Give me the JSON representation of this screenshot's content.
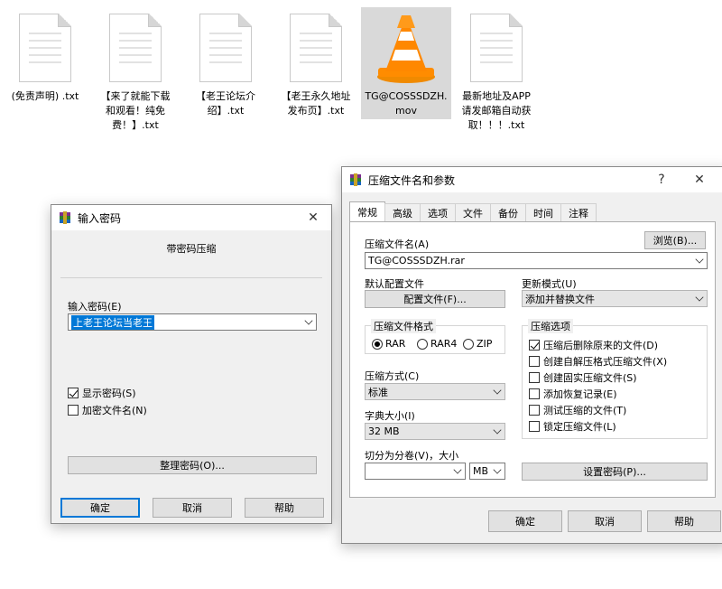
{
  "files": [
    {
      "name": "(免责声明) .txt",
      "type": "txt"
    },
    {
      "name": "【来了就能下载\n和观看！纯免\n费！】.txt",
      "type": "txt"
    },
    {
      "name": "【老王论坛介\n绍】.txt",
      "type": "txt"
    },
    {
      "name": "【老王永久地址\n发布页】.txt",
      "type": "txt"
    },
    {
      "name": "TG@COSSSDZH.\nmov",
      "type": "video"
    },
    {
      "name": "最新地址及APP\n请发邮箱自动获\n取！！！.txt",
      "type": "txt"
    }
  ],
  "password_dialog": {
    "title": "输入密码",
    "close": "✕",
    "subtitle": "带密码压缩",
    "password_label": "输入密码(E)",
    "password_value": "上老王论坛当老王",
    "show_password": "显示密码(S)",
    "encrypt_names": "加密文件名(N)",
    "organize_button": "整理密码(O)...",
    "ok": "确定",
    "cancel": "取消",
    "help": "帮助"
  },
  "archive_dialog": {
    "title": "压缩文件名和参数",
    "help_icon": "?",
    "close": "✕",
    "tabs": [
      "常规",
      "高级",
      "选项",
      "文件",
      "备份",
      "时间",
      "注释"
    ],
    "archive_name_label": "压缩文件名(A)",
    "browse": "浏览(B)...",
    "archive_name_value": "TG@COSSSDZH.rar",
    "default_profile_label": "默认配置文件",
    "profiles_button": "配置文件(F)...",
    "update_mode_label": "更新模式(U)",
    "update_mode_value": "添加并替换文件",
    "format_group": "压缩文件格式",
    "formats": [
      "RAR",
      "RAR4",
      "ZIP"
    ],
    "method_label": "压缩方式(C)",
    "method_value": "标准",
    "dict_label": "字典大小(I)",
    "dict_value": "32 MB",
    "split_label": "切分为分卷(V)，大小",
    "split_unit": "MB",
    "options_group": "压缩选项",
    "options": [
      {
        "label": "压缩后删除原来的文件(D)",
        "checked": true
      },
      {
        "label": "创建自解压格式压缩文件(X)",
        "checked": false
      },
      {
        "label": "创建固实压缩文件(S)",
        "checked": false
      },
      {
        "label": "添加恢复记录(E)",
        "checked": false
      },
      {
        "label": "测试压缩的文件(T)",
        "checked": false
      },
      {
        "label": "锁定压缩文件(L)",
        "checked": false
      }
    ],
    "set_password": "设置密码(P)...",
    "ok": "确定",
    "cancel": "取消",
    "help": "帮助"
  }
}
